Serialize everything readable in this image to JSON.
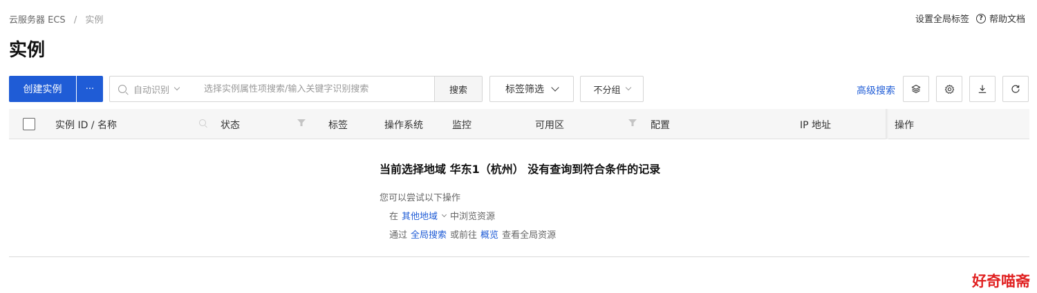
{
  "breadcrumb": {
    "root": "云服务器 ECS",
    "separator": "/",
    "current": "实例"
  },
  "header": {
    "global_tags": "设置全局标签",
    "help_mark": "?",
    "help_docs": "帮助文档"
  },
  "page_title": "实例",
  "toolbar": {
    "create_label": "创建实例",
    "more_label": "···",
    "auto_detect": "自动识别",
    "search_placeholder": "选择实例属性项搜索/输入关键字识别搜索",
    "search_button": "搜索",
    "tag_filter": "标签筛选",
    "group_select": "不分组",
    "advanced_search": "高级搜索"
  },
  "table": {
    "columns": {
      "id_name": "实例 ID / 名称",
      "status": "状态",
      "tags": "标签",
      "os": "操作系统",
      "monitor": "监控",
      "zone": "可用区",
      "config": "配置",
      "ip": "IP 地址",
      "actions": "操作"
    }
  },
  "empty_state": {
    "title": "当前选择地域 华东1（杭州） 没有查询到符合条件的记录",
    "subtitle": "您可以尝试以下操作",
    "line1_prefix": "在",
    "line1_link": "其他地域",
    "line1_suffix": "中浏览资源",
    "line2_prefix": "通过",
    "line2_link1": "全局搜索",
    "line2_mid": "或前往",
    "line2_link2": "概览",
    "line2_suffix": "查看全局资源"
  },
  "watermark": "好奇喵斋",
  "colors": {
    "primary": "#1f5cd6",
    "watermark": "#e02020"
  }
}
